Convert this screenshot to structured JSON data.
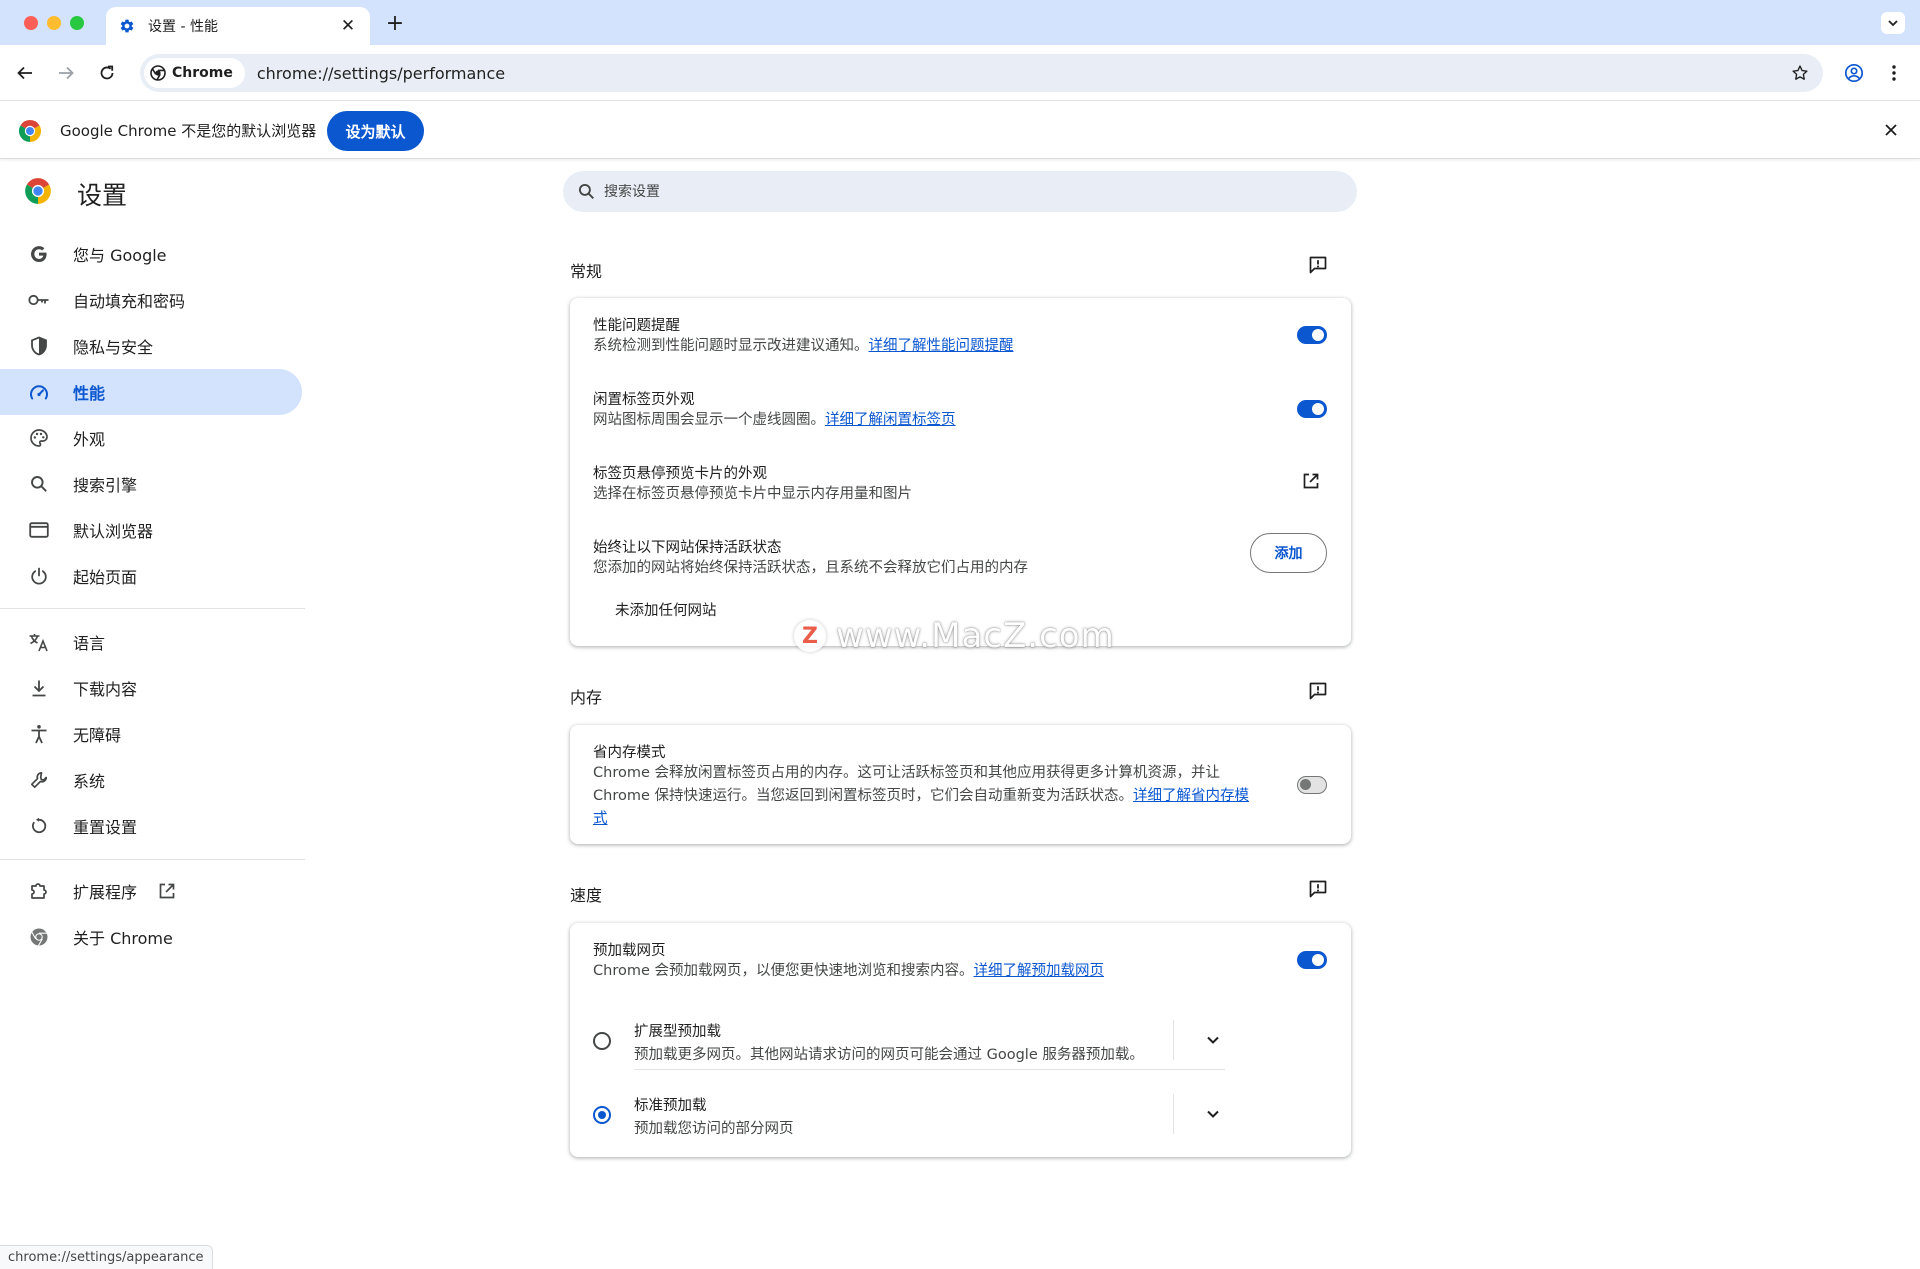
{
  "browser": {
    "tab_title": "设置 - 性能",
    "new_tab_symbol": "+",
    "close_symbol": "✕",
    "chip_label": "Chrome",
    "url": "chrome://settings/performance"
  },
  "infobar": {
    "message": "Google Chrome 不是您的默认浏览器",
    "set_default_label": "设为默认"
  },
  "settings": {
    "title": "设置",
    "search_placeholder": "搜索设置"
  },
  "sidebar": {
    "items": [
      {
        "label": "您与 Google",
        "icon": "google-g-icon"
      },
      {
        "label": "自动填充和密码",
        "icon": "key-icon"
      },
      {
        "label": "隐私与安全",
        "icon": "shield-icon"
      },
      {
        "label": "性能",
        "icon": "speedometer-icon",
        "active": true
      },
      {
        "label": "外观",
        "icon": "palette-icon"
      },
      {
        "label": "搜索引擎",
        "icon": "search-icon"
      },
      {
        "label": "默认浏览器",
        "icon": "browser-window-icon"
      },
      {
        "label": "起始页面",
        "icon": "power-icon"
      },
      {
        "label": "语言",
        "icon": "translate-icon"
      },
      {
        "label": "下载内容",
        "icon": "download-icon"
      },
      {
        "label": "无障碍",
        "icon": "accessibility-icon"
      },
      {
        "label": "系统",
        "icon": "wrench-icon"
      },
      {
        "label": "重置设置",
        "icon": "reset-icon"
      },
      {
        "label": "扩展程序",
        "icon": "puzzle-icon"
      },
      {
        "label": "关于 Chrome",
        "icon": "chrome-icon"
      }
    ]
  },
  "sections": {
    "general": {
      "title": "常规",
      "perf_alert": {
        "title": "性能问题提醒",
        "desc": "系统检测到性能问题时显示改进建议通知。",
        "link": "详细了解性能问题提醒",
        "enabled": true
      },
      "inactive_tabs": {
        "title": "闲置标签页外观",
        "desc": "网站图标周围会显示一个虚线圆圈。",
        "link": "详细了解闲置标签页",
        "enabled": true
      },
      "hover_card": {
        "title": "标签页悬停预览卡片的外观",
        "desc": "选择在标签页悬停预览卡片中显示内存用量和图片"
      },
      "keep_active": {
        "title": "始终让以下网站保持活跃状态",
        "desc": "您添加的网站将始终保持活跃状态，且系统不会释放它们占用的内存",
        "add_label": "添加",
        "empty_text": "未添加任何网站"
      }
    },
    "memory": {
      "title": "内存",
      "saver": {
        "title": "省内存模式",
        "desc_line1": "Chrome 会释放闲置标签页占用的内存。这可让活跃标签页和其他应用获得更多计算机资源，并让",
        "desc_line2": "Chrome 保持快速运行。当您返回到闲置标签页时，它们会自动重新变为活跃状态。",
        "link_part1": "详细了解省内存模",
        "link_part2": "式",
        "enabled": false
      }
    },
    "speed": {
      "title": "速度",
      "preload": {
        "title": "预加载网页",
        "desc": "Chrome 会预加载网页，以便您更快速地浏览和搜索内容。",
        "link": "详细了解预加载网页",
        "enabled": true
      },
      "options": [
        {
          "title": "扩展型预加载",
          "desc": "预加载更多网页。其他网站请求访问的网页可能会通过 Google 服务器预加载。",
          "selected": false
        },
        {
          "title": "标准预加载",
          "desc": "预加载您访问的部分网页",
          "selected": true
        }
      ]
    }
  },
  "watermark": {
    "logo": "Z",
    "text": "www.MacZ.com"
  },
  "status_url": "chrome://settings/appearance",
  "colors": {
    "accent": "#0b57d0",
    "active_nav_bg": "#d3e3fd",
    "tabstrip_bg": "#d3e3fd",
    "omnibox_bg": "#e9eef6"
  }
}
